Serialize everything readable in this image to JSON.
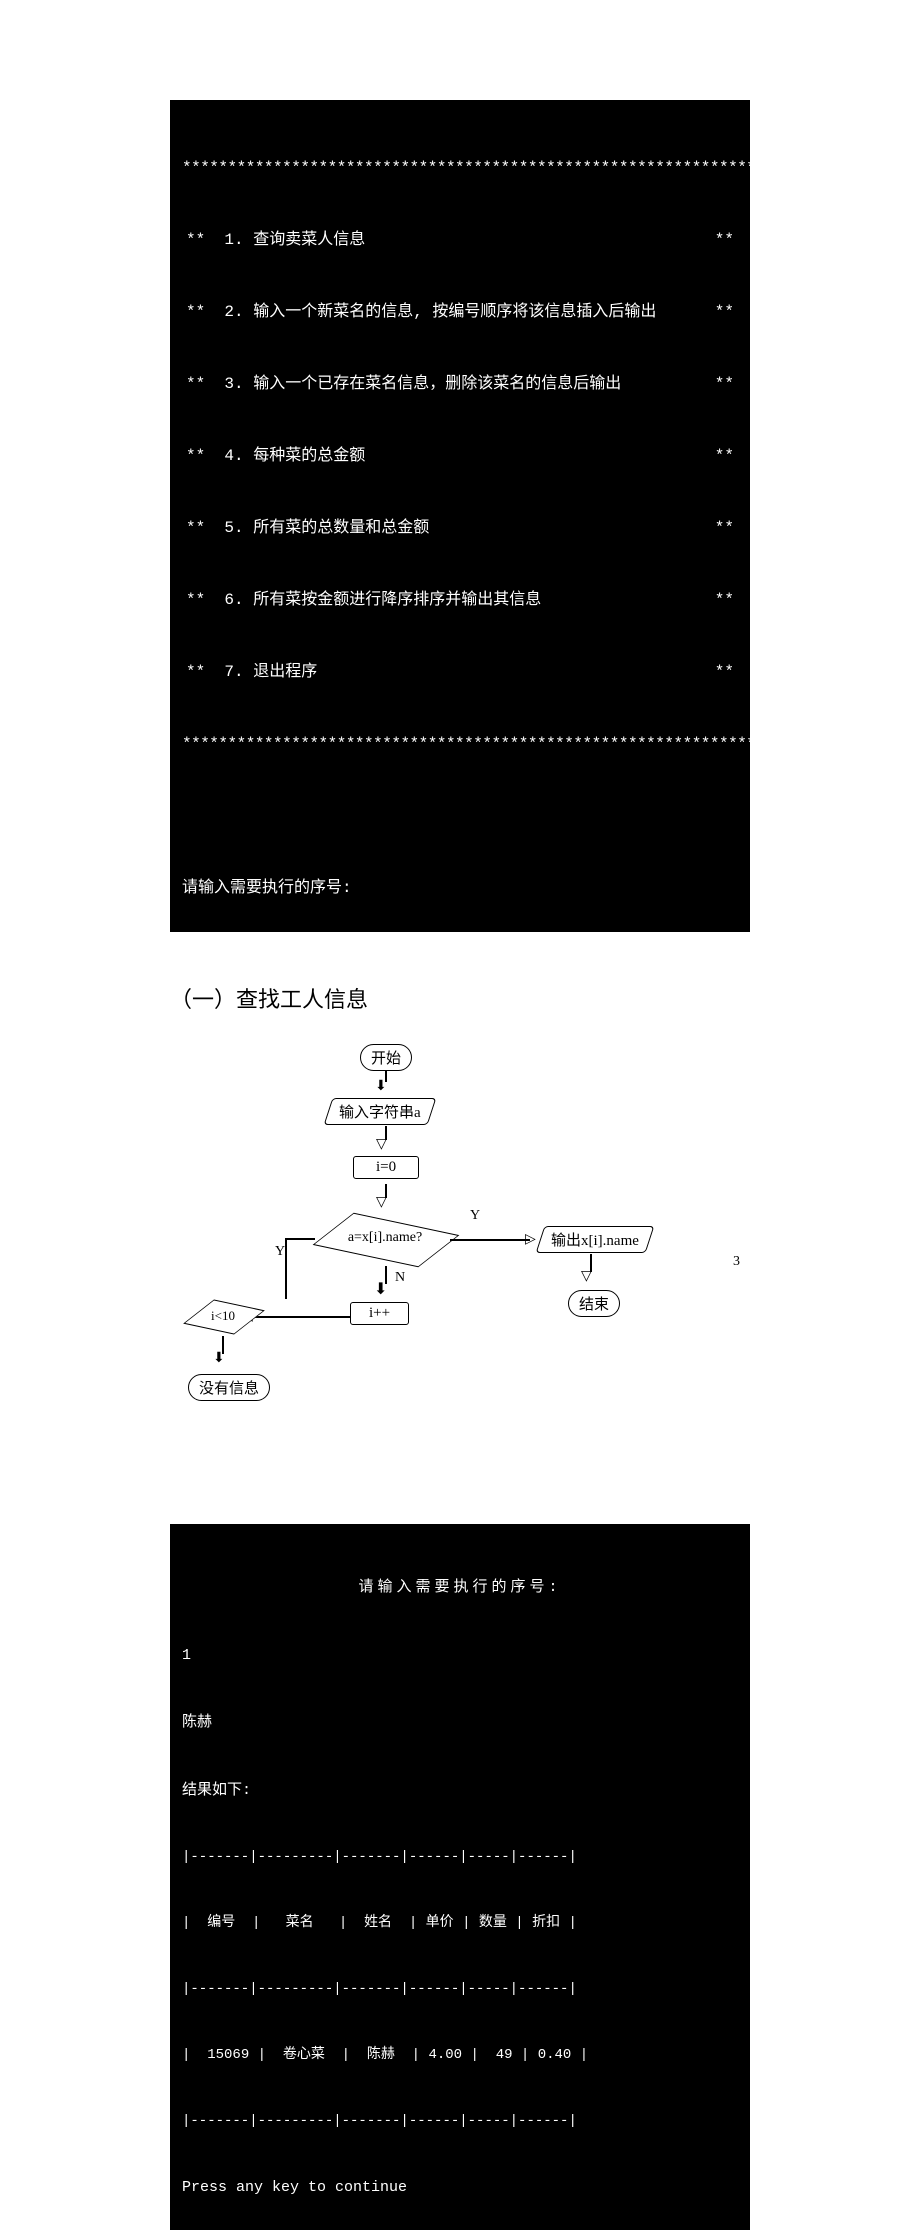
{
  "terminal_top": {
    "star_row": "***************************************************************",
    "menu_prefix": "**",
    "menu_suffix": "**",
    "items": [
      "  1. 查询卖菜人信息",
      "  2. 输入一个新菜名的信息, 按编号顺序将该信息插入后输出",
      "  3. 输入一个已存在菜名信息，删除该菜名的信息后输出",
      "  4. 每种菜的总金额",
      "  5. 所有菜的总数量和总金额",
      "  6. 所有菜按金额进行降序排序并输出其信息",
      "  7. 退出程序"
    ],
    "prompt": "请输入需要执行的序号:"
  },
  "section_title": "（一）查找工人信息",
  "chart_data": {
    "type": "flowchart",
    "nodes": [
      {
        "id": "start",
        "type": "terminator",
        "label": "开始"
      },
      {
        "id": "input_a",
        "type": "io",
        "label": "输入字符串a"
      },
      {
        "id": "init_i",
        "type": "process",
        "label": "i=0"
      },
      {
        "id": "cmp",
        "type": "decision",
        "label": "a=x[i].name?"
      },
      {
        "id": "output",
        "type": "io",
        "label": "输出x[i].name"
      },
      {
        "id": "end",
        "type": "terminator",
        "label": "结束"
      },
      {
        "id": "inc",
        "type": "process",
        "label": "i++"
      },
      {
        "id": "loop",
        "type": "decision",
        "label": "i<10"
      },
      {
        "id": "none",
        "type": "terminator",
        "label": "没有信息"
      }
    ],
    "edges": [
      {
        "from": "start",
        "to": "input_a"
      },
      {
        "from": "input_a",
        "to": "init_i"
      },
      {
        "from": "init_i",
        "to": "cmp"
      },
      {
        "from": "cmp",
        "to": "output",
        "label": "Y"
      },
      {
        "from": "output",
        "to": "end"
      },
      {
        "from": "cmp",
        "to": "inc",
        "label": "N"
      },
      {
        "from": "inc",
        "to": "loop"
      },
      {
        "from": "loop",
        "to": "cmp",
        "label": "Y"
      },
      {
        "from": "loop",
        "to": "none",
        "label": "N"
      }
    ]
  },
  "flowchart_labels": {
    "start": "开始",
    "input_a": "输入字符串a",
    "init_i": "i=0",
    "cmp": "a=x[i].name?",
    "output": "输出x[i].name",
    "end": "结束",
    "inc": "i++",
    "loop": "i<10",
    "none": "没有信息",
    "yes": "Y",
    "no": "N"
  },
  "terminal_result": {
    "prompt": "请输入需要执行的序号:",
    "input_line": "1",
    "name_line": "陈赫",
    "result_label": "结果如下:",
    "headers": [
      "编号",
      "菜名",
      "姓名",
      "单价",
      "数量",
      "折扣"
    ],
    "row": [
      "15069",
      "卷心菜",
      "陈赫",
      "4.00",
      "49",
      "0.40"
    ],
    "continue": "Press any key to continue"
  },
  "page_number": "3"
}
